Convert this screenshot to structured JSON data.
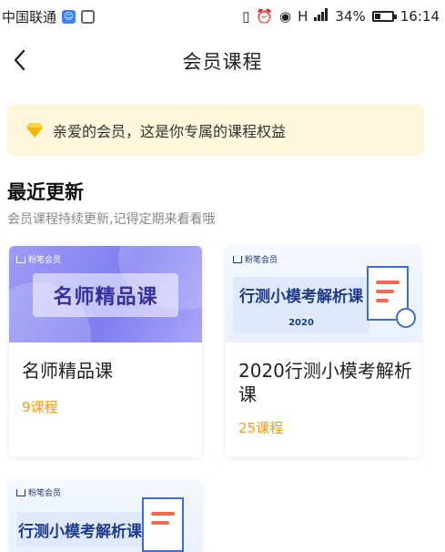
{
  "status_bar": {
    "carrier": "中国联通",
    "signal_mark": "H",
    "battery": "34%",
    "battery_level": 0.34,
    "time": "16:14"
  },
  "nav": {
    "title": "会员课程"
  },
  "banner": {
    "text": "亲爱的会员，这是你专属的课程权益",
    "icon": "diamond-icon",
    "background": "#fdf6dc"
  },
  "section": {
    "title": "最近更新",
    "subtitle": "会员课程持续更新,记得定期来看看哦"
  },
  "cards": [
    {
      "badge": "粉笔会员",
      "thumb_title": "名师精品课",
      "name": "名师精品课",
      "count": "9课程"
    },
    {
      "badge": "粉笔会员",
      "thumb_title": "行测小模考解析课",
      "thumb_year": "2020",
      "name": "2020行测小模考解析课",
      "count": "25课程"
    },
    {
      "badge": "粉笔会员",
      "thumb_title": "行测小模考解析课"
    }
  ],
  "colors": {
    "accent_orange": "#f39c12",
    "brand_blue": "#1d3b8f",
    "purple": "#7f7df0"
  }
}
